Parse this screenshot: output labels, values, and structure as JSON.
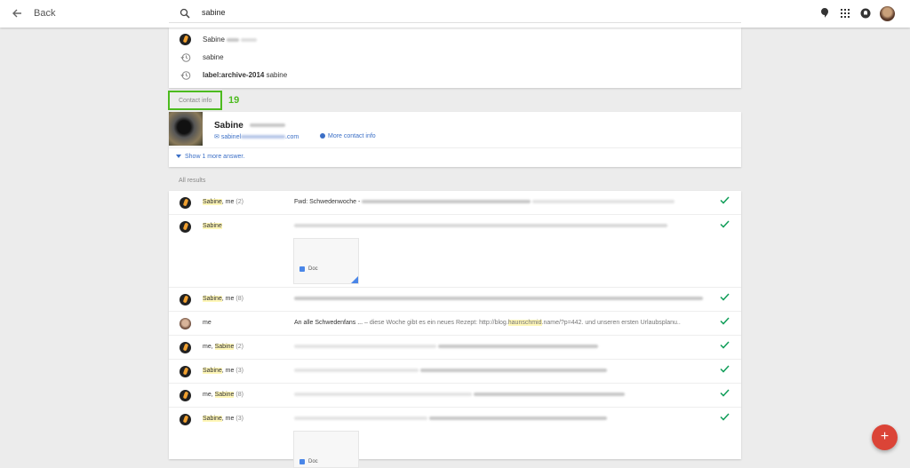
{
  "header": {
    "back_label": "Back",
    "search_value": "sabine"
  },
  "suggestions": [
    {
      "type": "contact",
      "text": "Sabine"
    },
    {
      "type": "history",
      "text": "sabine"
    },
    {
      "type": "history",
      "label_bold": "label:archive-2014",
      "text": "sabine"
    }
  ],
  "contact_info": {
    "section_label": "Contact info",
    "annotation": "19",
    "name": "Sabine",
    "email_prefix": "sabinel",
    "email_suffix": ".com",
    "more_label": "More contact info",
    "show_more": "Show 1 more answer."
  },
  "all_results_label": "All results",
  "results": [
    {
      "sender_hl": "Sabine",
      "sender_rest": ", me",
      "count": "(2)",
      "subject": "Fwd: Schwedenwoche -",
      "snippet": "",
      "checked": true
    },
    {
      "sender_hl": "Sabine",
      "sender_rest": "",
      "count": "",
      "subject": "",
      "snippet": "",
      "attachment": "Doc",
      "checked": true
    },
    {
      "sender_hl": "Sabine",
      "sender_rest": ", me",
      "count": "(8)",
      "subject": "",
      "snippet": "",
      "checked": true
    },
    {
      "sender_plain": "me",
      "subject": "An alle Schwedenfans ...",
      "snippet_a": " – diese Woche gibt es ein neues Rezept: http://blog.",
      "snippet_hl": "haunschmid",
      "snippet_b": ".name/?p=442. und unseren ersten Urlaubsplanu..",
      "checked": true
    },
    {
      "sender_pre": "me, ",
      "sender_hl": "Sabine",
      "count": "(2)",
      "subject": "",
      "snippet": "",
      "checked": true
    },
    {
      "sender_hl": "Sabine",
      "sender_rest": ", me",
      "count": "(3)",
      "subject": "",
      "snippet": "",
      "checked": true
    },
    {
      "sender_pre": "me, ",
      "sender_hl": "Sabine",
      "count": "(8)",
      "subject": "",
      "snippet": "",
      "checked": true
    },
    {
      "sender_hl": "Sabine",
      "sender_rest": ", me",
      "count": "(3)",
      "subject": "",
      "snippet": "",
      "attachment": "Doc",
      "checked": true
    }
  ],
  "fab_label": "+",
  "colors": {
    "accent": "#4dbb1f",
    "link": "#3b6fc6",
    "fab": "#db4437",
    "check": "#0f9d58"
  }
}
